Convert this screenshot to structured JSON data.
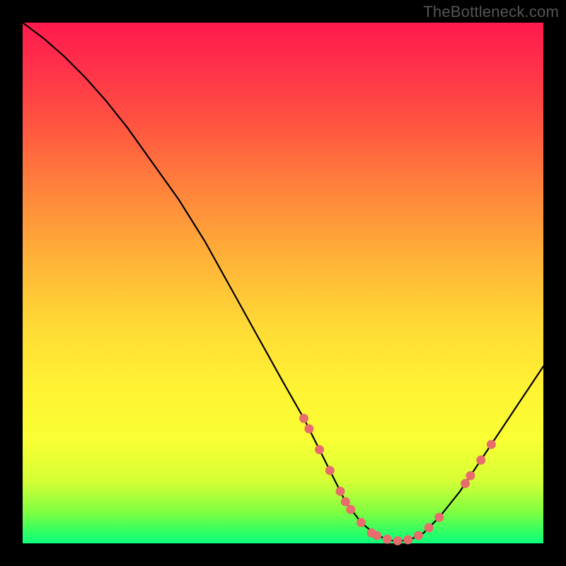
{
  "watermark": "TheBottleneck.com",
  "colors": {
    "frame_bg": "#000000",
    "gradient_top": "#ff1a4d",
    "gradient_bottom": "#0cff7c",
    "curve": "#000000",
    "dot_fill": "#e86c6c"
  },
  "chart_data": {
    "type": "line",
    "title": "",
    "xlabel": "",
    "ylabel": "",
    "xlim": [
      0,
      100
    ],
    "ylim": [
      0,
      100
    ],
    "grid": false,
    "legend": false,
    "annotations": [
      "TheBottleneck.com"
    ],
    "series": [
      {
        "name": "bottleneck-curve",
        "x": [
          0,
          4,
          8,
          12,
          16,
          20,
          25,
          30,
          35,
          40,
          45,
          50,
          54,
          57,
          60,
          62,
          65,
          68,
          71,
          74,
          77,
          80,
          84,
          88,
          92,
          96,
          100
        ],
        "y": [
          100,
          97,
          93.5,
          89.5,
          85,
          80,
          73,
          66,
          58,
          49,
          40,
          31,
          24,
          18,
          12,
          8,
          4,
          1.5,
          0.5,
          0.5,
          2,
          5,
          10,
          16,
          22,
          28,
          34
        ]
      }
    ],
    "markers": [
      {
        "x": 54,
        "y": 24
      },
      {
        "x": 55,
        "y": 22
      },
      {
        "x": 57,
        "y": 18
      },
      {
        "x": 59,
        "y": 14
      },
      {
        "x": 61,
        "y": 10
      },
      {
        "x": 62,
        "y": 8
      },
      {
        "x": 63,
        "y": 6.5
      },
      {
        "x": 65,
        "y": 4
      },
      {
        "x": 67,
        "y": 2
      },
      {
        "x": 68,
        "y": 1.5
      },
      {
        "x": 70,
        "y": 0.8
      },
      {
        "x": 72,
        "y": 0.5
      },
      {
        "x": 74,
        "y": 0.7
      },
      {
        "x": 76,
        "y": 1.5
      },
      {
        "x": 78,
        "y": 3
      },
      {
        "x": 80,
        "y": 5
      },
      {
        "x": 85,
        "y": 11.5
      },
      {
        "x": 86,
        "y": 13
      },
      {
        "x": 88,
        "y": 16
      },
      {
        "x": 90,
        "y": 19
      }
    ]
  }
}
